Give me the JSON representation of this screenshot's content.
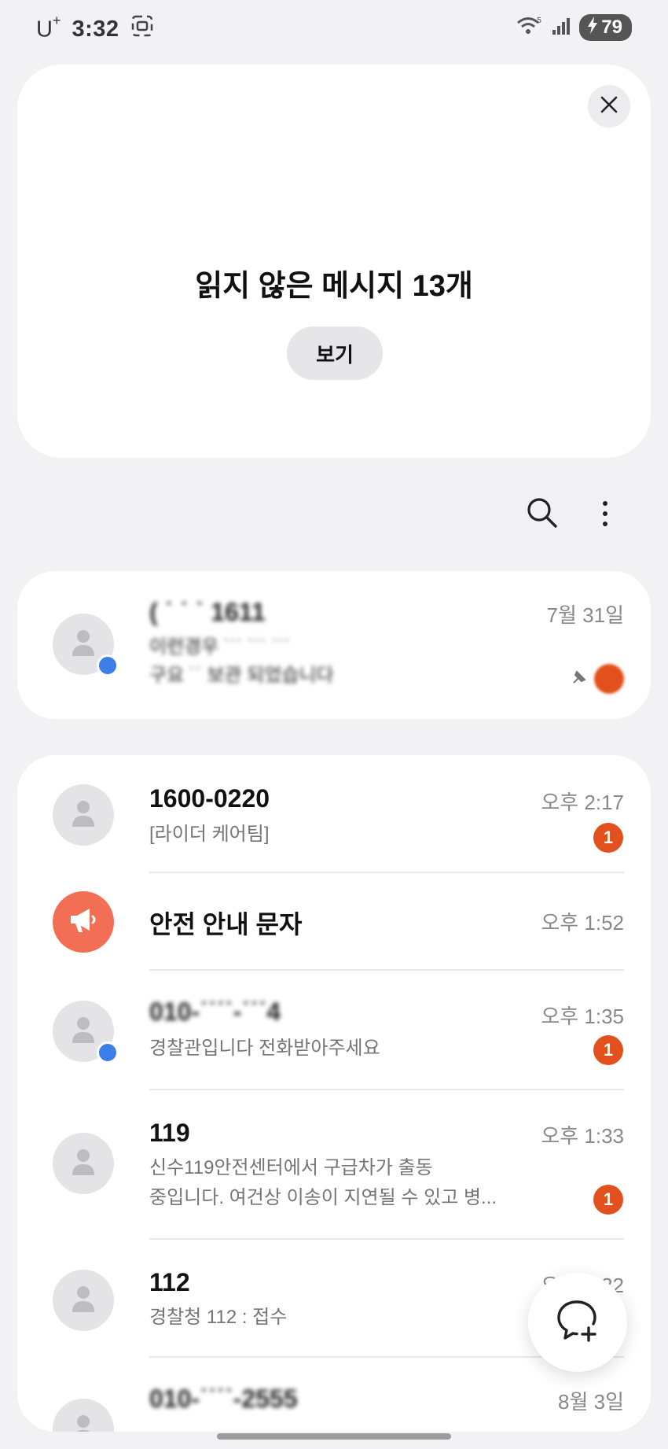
{
  "status_bar": {
    "carrier": "U",
    "carrier_sup": "+",
    "time": "3:32",
    "battery": "79",
    "network": "5"
  },
  "unread_banner": {
    "title": "읽지 않은 메시지 13개",
    "view_label": "보기"
  },
  "pinned": [
    {
      "name": "( ˙ ˙ ˙ 1611",
      "time": "7월 31일",
      "preview_line1": "이런경우 ˙˙˙ ˙˙˙ ˙˙˙",
      "preview_line2": "구요 ˙˙ 보관 되었습니다"
    }
  ],
  "conversations": [
    {
      "name": "1600-0220",
      "time": "오후 2:17",
      "preview": "[라이더 케어팀]",
      "badge": "1",
      "icon": "person-icon",
      "has_chat_dot": false
    },
    {
      "name": "안전 안내 문자",
      "time": "오후 1:52",
      "preview": "",
      "badge": "",
      "icon": "megaphone-icon",
      "has_chat_dot": false
    },
    {
      "name": "010-˙˙˙˙-˙˙˙4",
      "time": "오후 1:35",
      "preview": "경찰관입니다 전화받아주세요",
      "badge": "1",
      "icon": "person-icon",
      "has_chat_dot": true
    },
    {
      "name": "119",
      "time": "오후 1:33",
      "preview": "신수119안전센터에서 구급차가 출동",
      "preview2": "중입니다. 여건상 이송이 지연될 수 있고 병...",
      "badge": "1",
      "icon": "person-icon",
      "has_chat_dot": false
    },
    {
      "name": "112",
      "time": "오후 1:32",
      "preview": "경찰청 112 : 접수",
      "badge": "",
      "icon": "person-icon",
      "has_chat_dot": false
    },
    {
      "name": "010-˙˙˙˙-2555",
      "time": "8월 3일",
      "preview": "",
      "badge": "",
      "icon": "person-icon",
      "has_chat_dot": false
    }
  ],
  "colors": {
    "accent_badge": "#e2511d",
    "chat_dot": "#3b7ee8",
    "alert_avatar": "#f26f55"
  }
}
